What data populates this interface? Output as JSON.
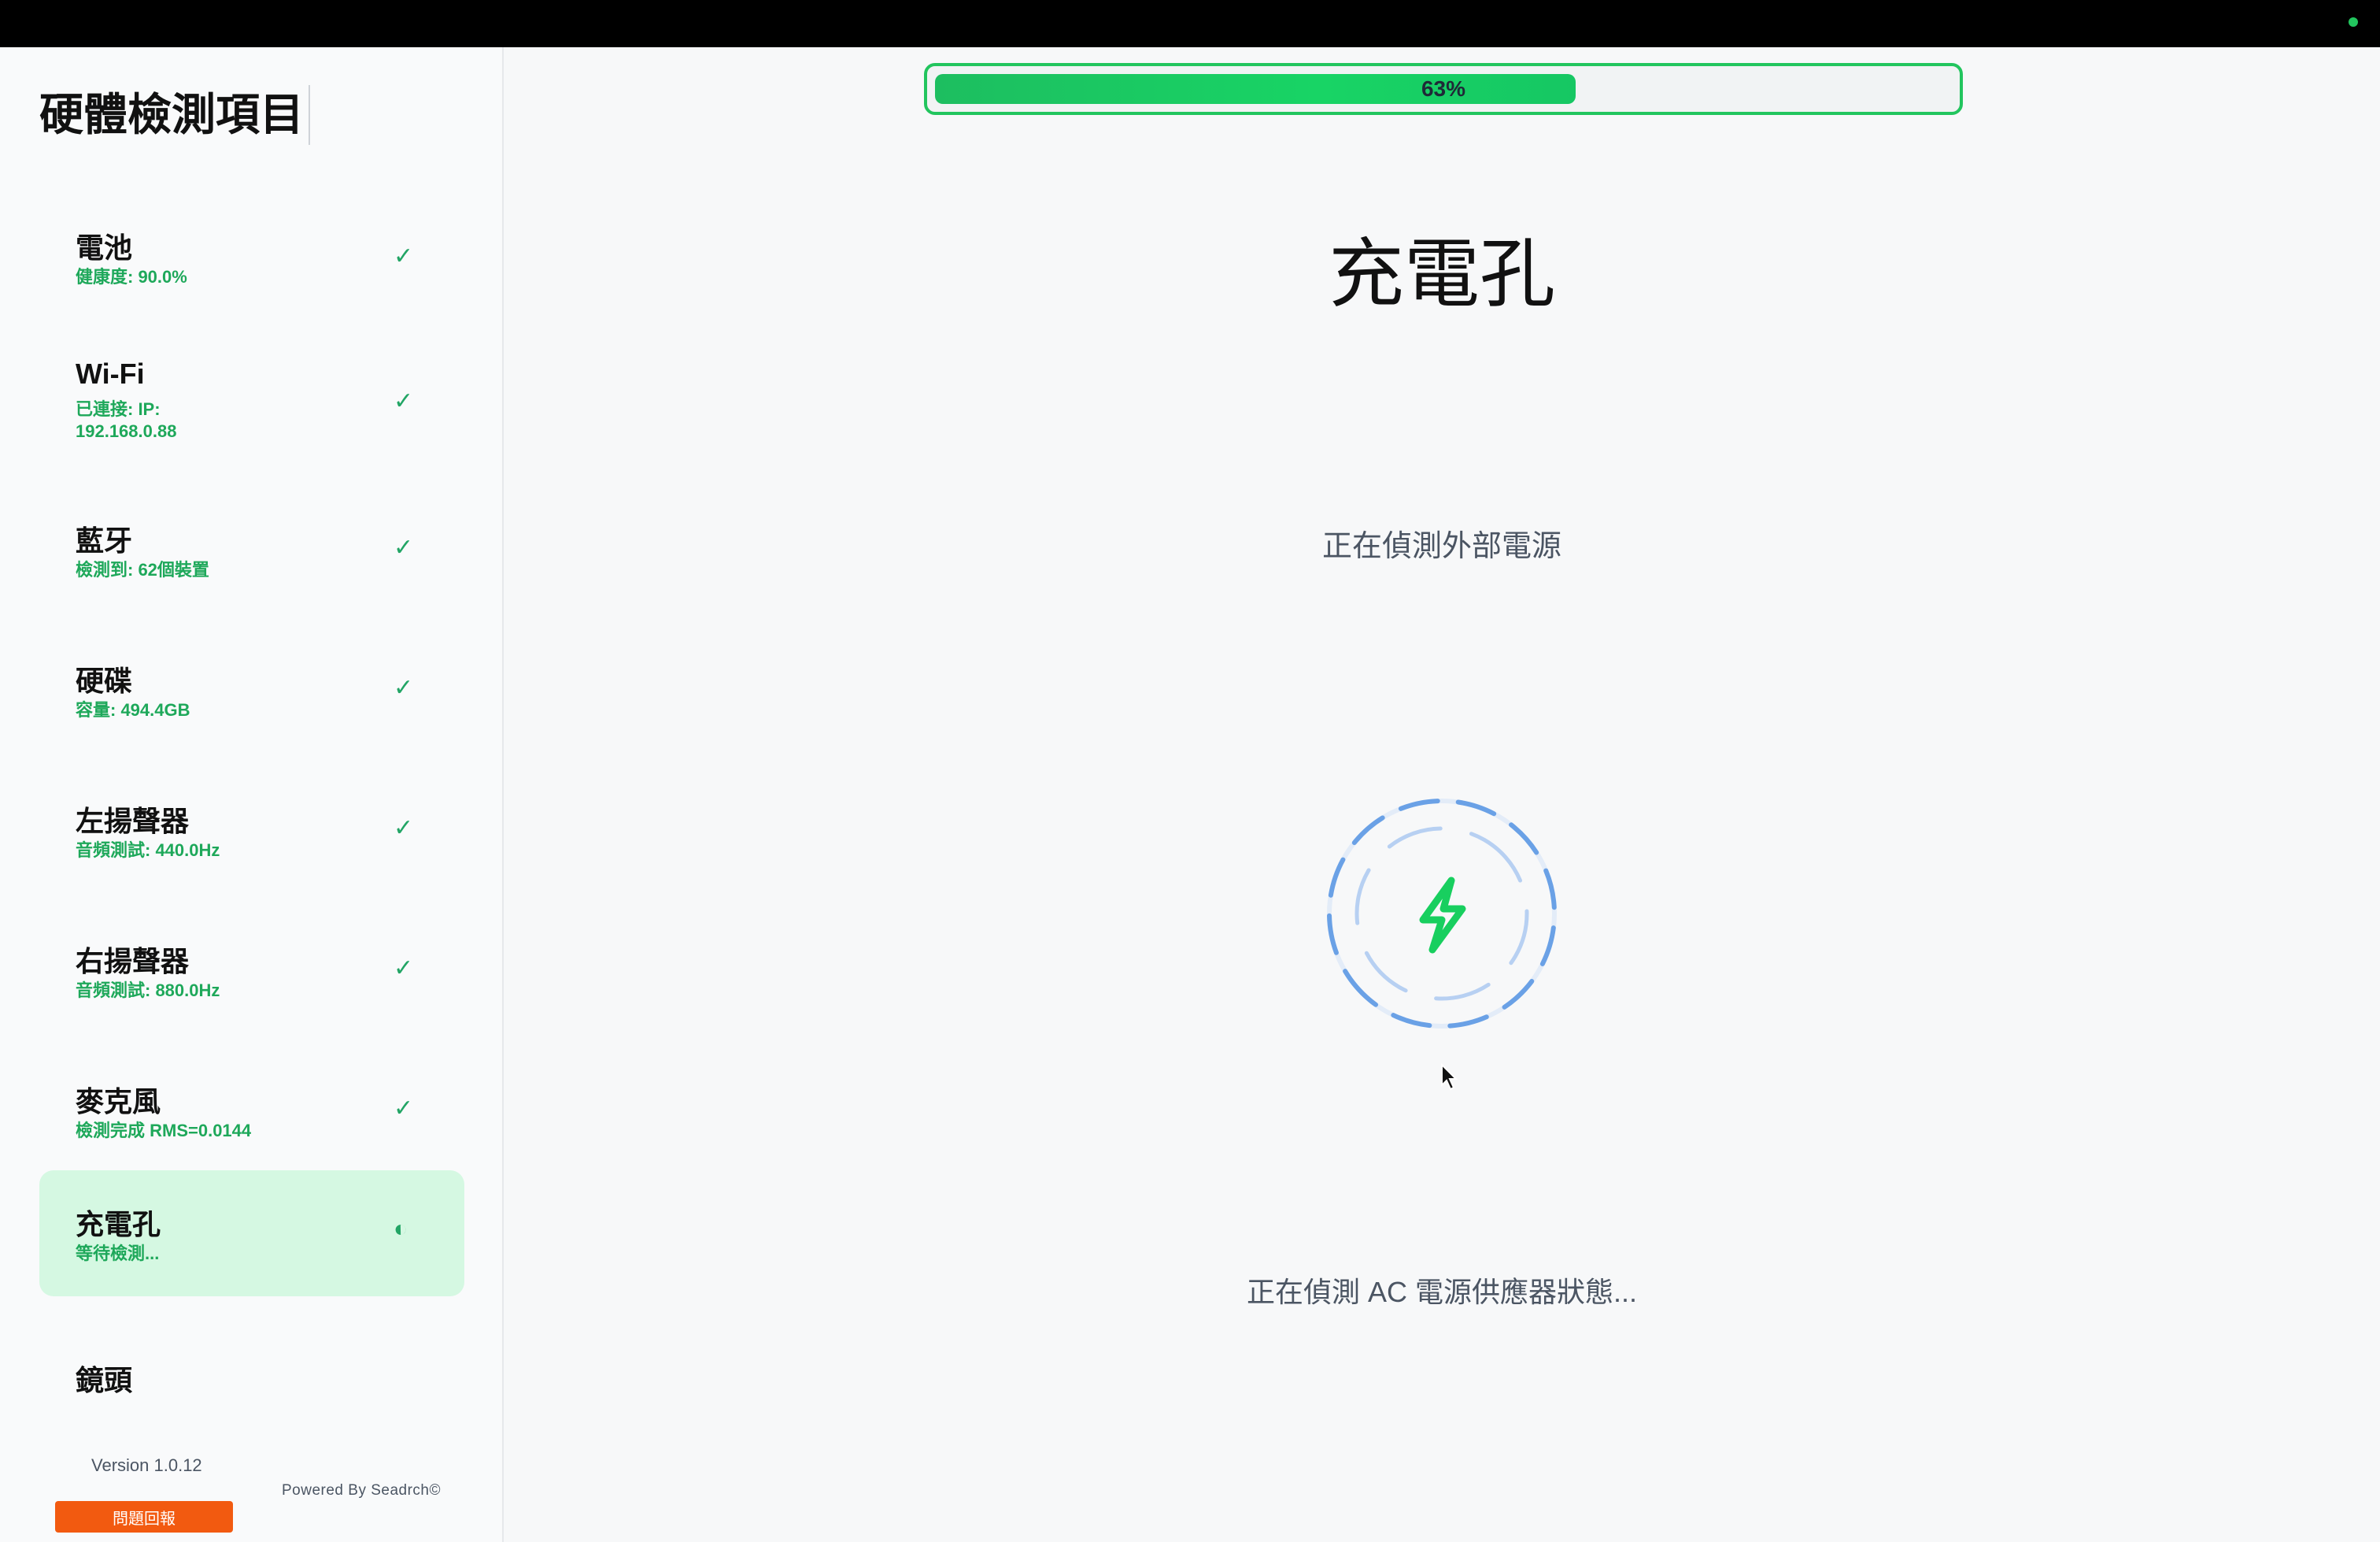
{
  "sidebar": {
    "title": "硬體檢測項目",
    "items": [
      {
        "name": "電池",
        "sub": "健康度: 90.0%",
        "status": "✓"
      },
      {
        "name": "Wi-Fi",
        "sub": "已連接: IP: 192.168.0.88",
        "status": "✓"
      },
      {
        "name": "藍牙",
        "sub": "檢測到: 62個裝置",
        "status": "✓"
      },
      {
        "name": "硬碟",
        "sub": "容量: 494.4GB",
        "status": "✓"
      },
      {
        "name": "左揚聲器",
        "sub": "音頻測試: 440.0Hz",
        "status": "✓"
      },
      {
        "name": "右揚聲器",
        "sub": "音頻測試: 880.0Hz",
        "status": "✓"
      },
      {
        "name": "麥克風",
        "sub": "檢測完成 RMS=0.0144",
        "status": "✓"
      },
      {
        "name": "充電孔",
        "sub": "等待檢測...",
        "status": "◐"
      },
      {
        "name": "鏡頭",
        "sub": "",
        "status": ""
      }
    ],
    "version": "Version 1.0.12",
    "powered_by": "Powered By Seadrch©",
    "report_button": "問題回報"
  },
  "progress": {
    "value": 0.63,
    "label": "63%"
  },
  "main": {
    "title": "充電孔",
    "detecting": "正在偵測外部電源",
    "status": "正在偵測 AC 電源供應器狀態..."
  },
  "colors": {
    "accent_green": "#22c55e",
    "active_bg": "#d5f8e2",
    "report_orange": "#f25a10",
    "spinner_blue": "#4a8fe0"
  },
  "icons": {
    "status_done": "check-icon",
    "status_pending": "half-circle-icon",
    "center": "lightning-bolt-icon"
  }
}
